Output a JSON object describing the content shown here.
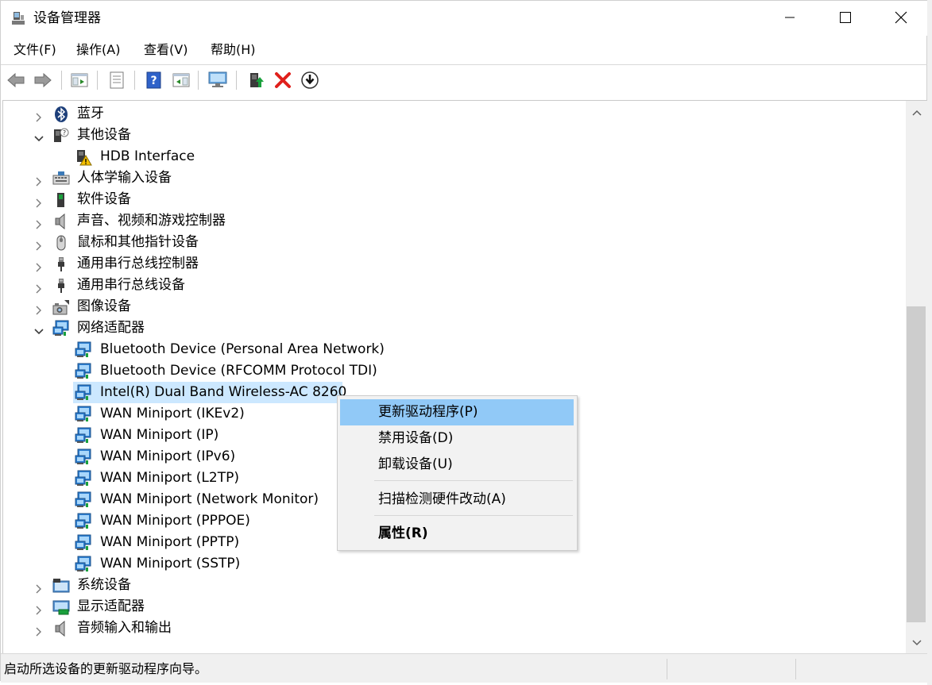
{
  "window": {
    "title": "设备管理器"
  },
  "menubar": {
    "items": [
      {
        "label": "文件(F)"
      },
      {
        "label": "操作(A)"
      },
      {
        "label": "查看(V)"
      },
      {
        "label": "帮助(H)"
      }
    ]
  },
  "tree": {
    "nodes": [
      {
        "label": "蓝牙",
        "icon": "bluetooth-icon",
        "expanded": false
      },
      {
        "label": "其他设备",
        "icon": "unknown-device-icon",
        "expanded": true
      },
      {
        "label": "HDB Interface",
        "icon": "warning-device-icon"
      },
      {
        "label": "人体学输入设备",
        "icon": "keyboard-icon",
        "expanded": false
      },
      {
        "label": "软件设备",
        "icon": "software-device-icon",
        "expanded": false
      },
      {
        "label": "声音、视频和游戏控制器",
        "icon": "speaker-icon",
        "expanded": false
      },
      {
        "label": "鼠标和其他指针设备",
        "icon": "mouse-icon",
        "expanded": false
      },
      {
        "label": "通用串行总线控制器",
        "icon": "usb-icon",
        "expanded": false
      },
      {
        "label": "通用串行总线设备",
        "icon": "usb-icon",
        "expanded": false
      },
      {
        "label": "图像设备",
        "icon": "camera-icon",
        "expanded": false
      },
      {
        "label": "网络适配器",
        "icon": "network-icon",
        "expanded": true
      },
      {
        "label": "Bluetooth Device (Personal Area Network)",
        "icon": "network-icon"
      },
      {
        "label": "Bluetooth Device (RFCOMM Protocol TDI)",
        "icon": "network-icon"
      },
      {
        "label": "Intel(R) Dual Band Wireless-AC 8260",
        "icon": "network-icon",
        "selected": true
      },
      {
        "label": "WAN Miniport (IKEv2)",
        "icon": "network-icon"
      },
      {
        "label": "WAN Miniport (IP)",
        "icon": "network-icon"
      },
      {
        "label": "WAN Miniport (IPv6)",
        "icon": "network-icon"
      },
      {
        "label": "WAN Miniport (L2TP)",
        "icon": "network-icon"
      },
      {
        "label": "WAN Miniport (Network Monitor)",
        "icon": "network-icon"
      },
      {
        "label": "WAN Miniport (PPPOE)",
        "icon": "network-icon"
      },
      {
        "label": "WAN Miniport (PPTP)",
        "icon": "network-icon"
      },
      {
        "label": "WAN Miniport (SSTP)",
        "icon": "network-icon"
      },
      {
        "label": "系统设备",
        "icon": "system-device-icon",
        "expanded": false
      },
      {
        "label": "显示适配器",
        "icon": "display-adapter-icon",
        "expanded": false
      },
      {
        "label": "音频输入和输出",
        "icon": "speaker-icon",
        "expanded": false
      }
    ]
  },
  "context_menu": {
    "items": [
      {
        "label": "更新驱动程序(P)",
        "highlighted": true
      },
      {
        "label": "禁用设备(D)"
      },
      {
        "label": "卸载设备(U)"
      },
      {
        "label": "扫描检测硬件改动(A)"
      },
      {
        "label": "属性(R)",
        "bold": true
      }
    ]
  },
  "statusbar": {
    "text": "启动所选设备的更新驱动程序向导。"
  },
  "colors": {
    "selection": "#cce8ff",
    "menu_highlight": "#91c9f7",
    "delete_red": "#e0201c",
    "nav_green": "#1aa03c"
  }
}
